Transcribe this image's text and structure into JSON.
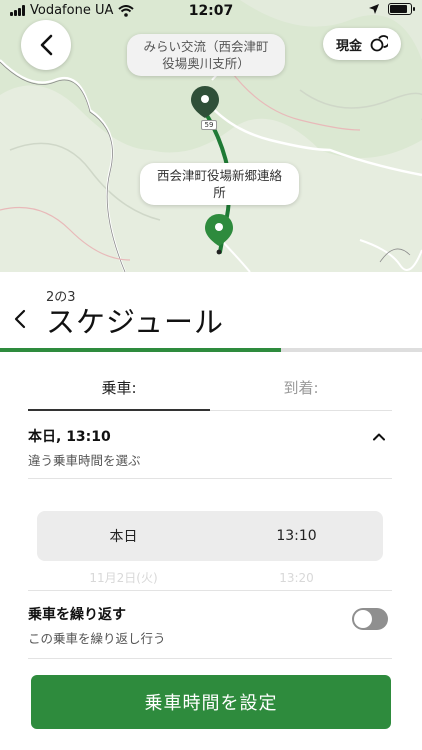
{
  "status_bar": {
    "carrier": "Vodafone UA",
    "time": "12:07",
    "battery_level": 0.85
  },
  "map": {
    "pickup_label": "みらい交流（西会津町役場奥川支所）",
    "pickup_label_line1": "みらい交流（西会津町",
    "pickup_label_line2": "役場奥川支所）",
    "dropoff_label_line1": "西会津町役場新郷連絡",
    "dropoff_label_line2": "所",
    "road_marker": "59",
    "payment_label": "現金",
    "route_color": "#1f7a35",
    "pin_dark_color": "#2f4f38",
    "pin_green_color": "#2e8b3d"
  },
  "sheet": {
    "step": "2の3",
    "title": "スケジュール",
    "progress_fraction": 0.667,
    "tabs": [
      {
        "label": "乗車:",
        "active": true
      },
      {
        "label": "到着:",
        "active": false
      }
    ],
    "selected_time": "本日, 13:10",
    "selected_time_hint": "違う乗車時間を選ぶ",
    "picker": {
      "day": "本日",
      "time": "13:10",
      "next_day": "11月2日(火)",
      "next_time": "13:20"
    },
    "repeat": {
      "title": "乗車を繰り返す",
      "subtitle": "この乗車を繰り返し行う",
      "enabled": false
    },
    "cta_label": "乗車時間を設定",
    "accent_color": "#2e8b3d"
  }
}
